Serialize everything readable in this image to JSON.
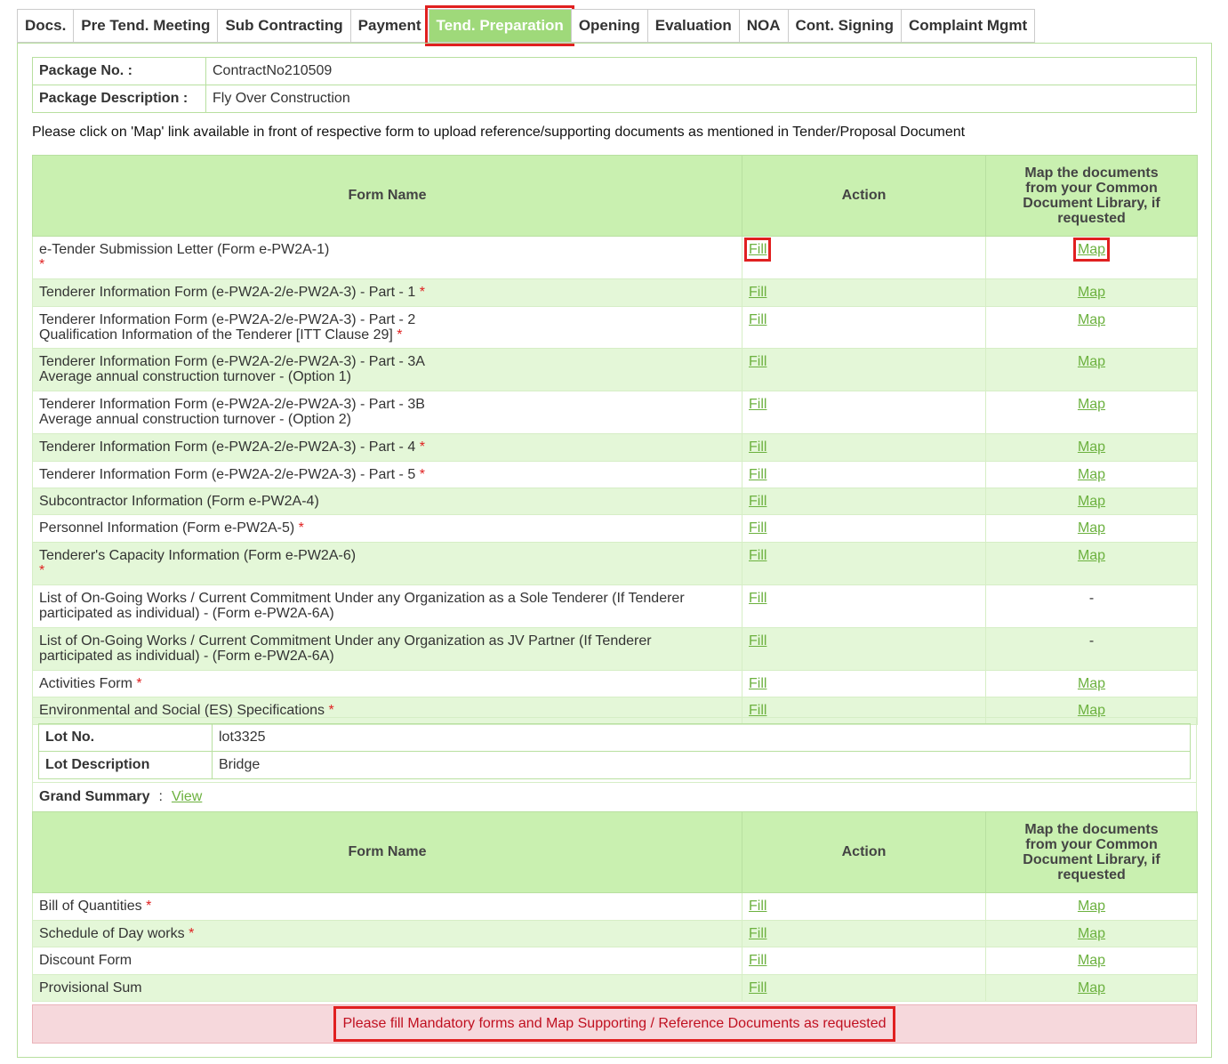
{
  "tabs": [
    {
      "label": "Docs."
    },
    {
      "label": "Pre Tend. Meeting"
    },
    {
      "label": "Sub Contracting"
    },
    {
      "label": "Payment"
    },
    {
      "label": "Tend. Preparation",
      "active": true
    },
    {
      "label": "Opening"
    },
    {
      "label": "Evaluation"
    },
    {
      "label": "NOA"
    },
    {
      "label": "Cont. Signing"
    },
    {
      "label": "Complaint Mgmt"
    }
  ],
  "package": {
    "no_label": "Package No. :",
    "no_value": "ContractNo210509",
    "desc_label": "Package Description :",
    "desc_value": "Fly Over Construction"
  },
  "note": "Please click on 'Map' link available in front of respective form to upload reference/supporting documents as mentioned in Tender/Proposal Document",
  "table_headers": {
    "form_name": "Form Name",
    "action": "Action",
    "map": "Map the documents from your Common Document Library, if requested"
  },
  "links": {
    "fill": "Fill",
    "map": "Map",
    "dash": "-",
    "view": "View",
    "star": "*"
  },
  "forms": [
    {
      "line1": "e-Tender Submission Letter (Form e-PW2A-1)",
      "line2": "",
      "mandatory": true,
      "star_newline": true,
      "map": true
    },
    {
      "line1": "Tenderer Information Form (e-PW2A-2/e-PW2A-3) - Part - 1",
      "line2": "",
      "mandatory": true,
      "map": true
    },
    {
      "line1": "Tenderer Information Form (e-PW2A-2/e-PW2A-3) - Part - 2",
      "line2": "Qualification Information of the Tenderer [ITT Clause 29]",
      "mandatory": true,
      "map": true
    },
    {
      "line1": "Tenderer Information Form (e-PW2A-2/e-PW2A-3) - Part - 3A",
      "line2": "Average annual construction turnover - (Option 1)",
      "mandatory": false,
      "map": true
    },
    {
      "line1": "Tenderer Information Form (e-PW2A-2/e-PW2A-3) - Part - 3B",
      "line2": "Average annual construction turnover - (Option 2)",
      "mandatory": false,
      "map": true
    },
    {
      "line1": "Tenderer Information Form (e-PW2A-2/e-PW2A-3) - Part - 4",
      "line2": "",
      "mandatory": true,
      "map": true
    },
    {
      "line1": "Tenderer Information Form (e-PW2A-2/e-PW2A-3) - Part - 5",
      "line2": "",
      "mandatory": true,
      "map": true
    },
    {
      "line1": "Subcontractor Information (Form e-PW2A-4)",
      "line2": "",
      "mandatory": false,
      "map": true
    },
    {
      "line1": "Personnel Information (Form e-PW2A-5)",
      "line2": "",
      "mandatory": true,
      "map": true
    },
    {
      "line1": "Tenderer's Capacity Information (Form e-PW2A-6)",
      "line2": "",
      "mandatory": true,
      "star_newline": true,
      "map": true
    },
    {
      "line1": "List of On-Going Works / Current Commitment Under any Organization as a Sole Tenderer (If Tenderer",
      "line2": "participated as individual) - (Form e-PW2A-6A)",
      "mandatory": false,
      "map": false
    },
    {
      "line1": "List of On-Going Works / Current Commitment Under any Organization as JV Partner (If Tenderer",
      "line2": "participated as individual) - (Form e-PW2A-6A)",
      "mandatory": false,
      "map": false
    },
    {
      "line1": "Activities Form",
      "line2": "",
      "mandatory": true,
      "map": true
    },
    {
      "line1": "Environmental and Social (ES) Specifications",
      "line2": "",
      "mandatory": true,
      "map": true
    }
  ],
  "lot": {
    "no_label": "Lot No.",
    "no_value": "lot3325",
    "desc_label": "Lot Description",
    "desc_value": "Bridge"
  },
  "grand_summary": {
    "label": "Grand Summary",
    "sep": ":"
  },
  "lot_forms": [
    {
      "line1": "Bill of Quantities",
      "line2": "",
      "mandatory": true,
      "map": true
    },
    {
      "line1": "Schedule of Day works",
      "line2": "",
      "mandatory": true,
      "map": true
    },
    {
      "line1": "Discount Form",
      "line2": "",
      "mandatory": false,
      "map": true
    },
    {
      "line1": "Provisional Sum",
      "line2": "",
      "mandatory": false,
      "map": true
    }
  ],
  "alert": "Please fill Mandatory forms and Map Supporting / Reference Documents as requested"
}
